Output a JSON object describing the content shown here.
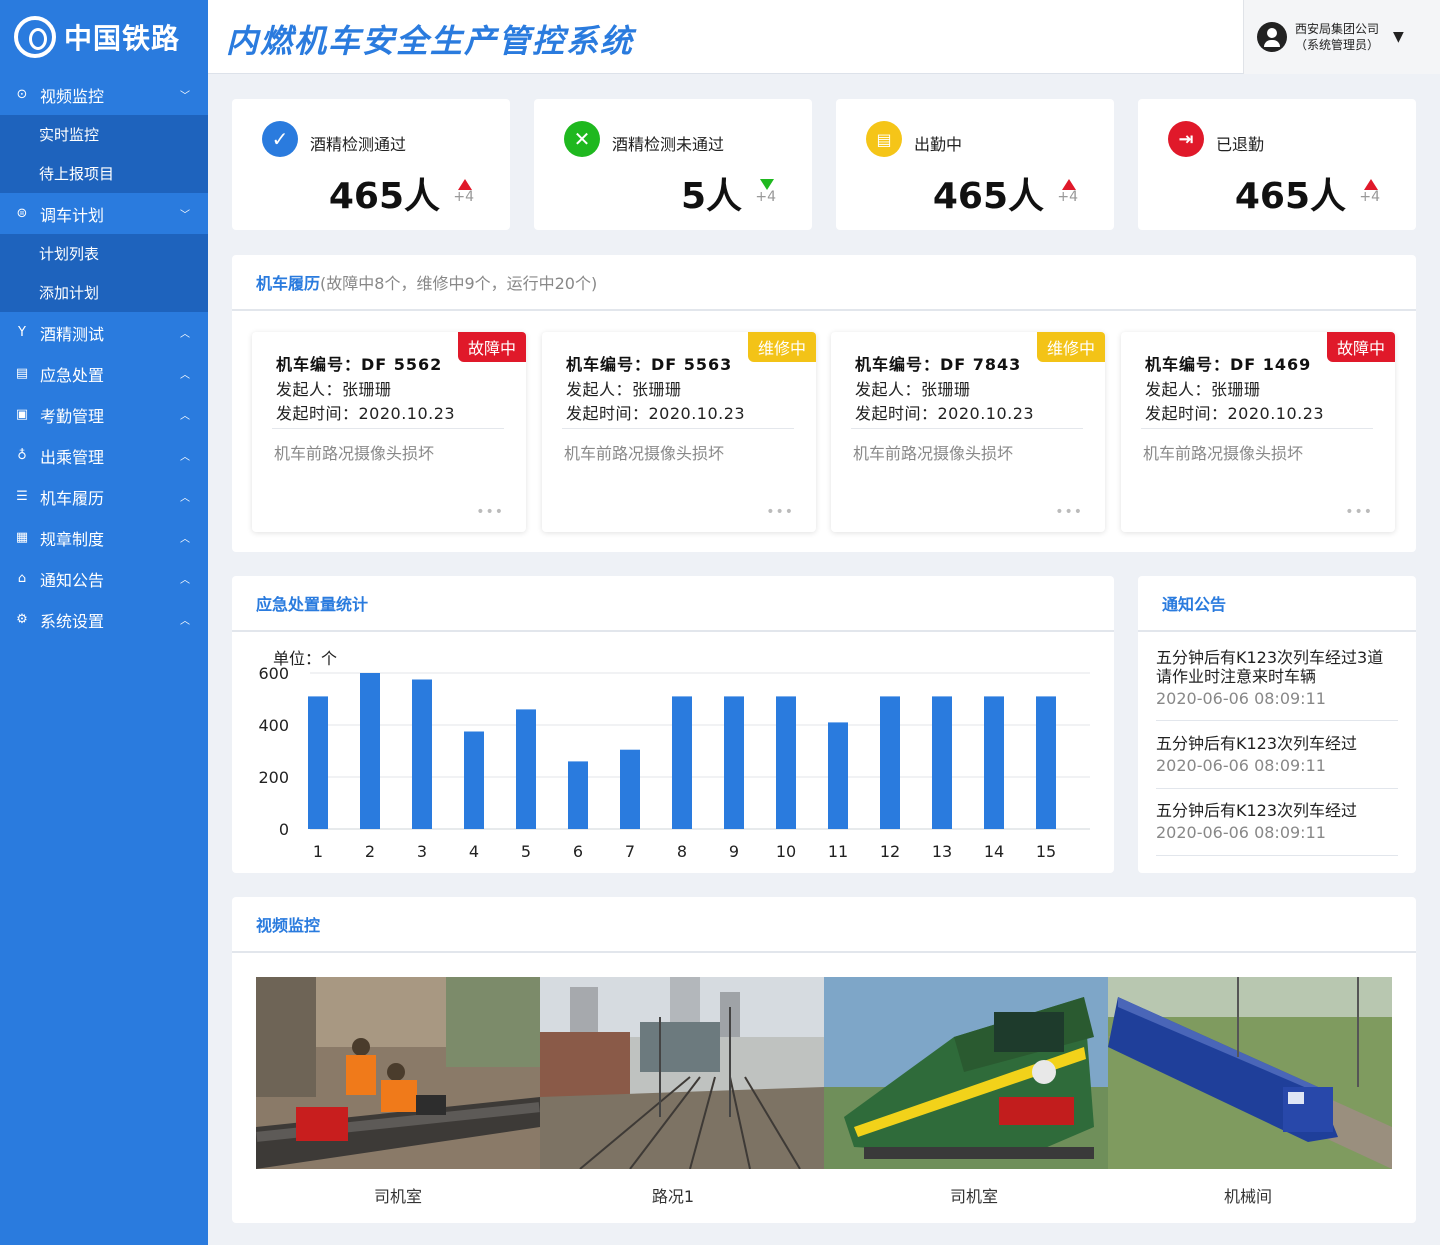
{
  "app": {
    "logo_text": "中国铁路",
    "title": "内燃机车安全生产管控系统"
  },
  "user": {
    "company": "西安局集团公司",
    "role": "（系统管理员）"
  },
  "sidebar": {
    "groups": [
      {
        "label": "视频监控",
        "icon": "camera-icon",
        "expanded": true,
        "children": [
          "实时监控",
          "待上报项目"
        ]
      },
      {
        "label": "调车计划",
        "icon": "plan-icon",
        "expanded": true,
        "children": [
          "计划列表",
          "添加计划"
        ]
      },
      {
        "label": "酒精测试",
        "icon": "glass-icon",
        "expanded": false
      },
      {
        "label": "应急处置",
        "icon": "emergency-icon",
        "expanded": false
      },
      {
        "label": "考勤管理",
        "icon": "calendar-icon",
        "expanded": false
      },
      {
        "label": "出乘管理",
        "icon": "location-icon",
        "expanded": false
      },
      {
        "label": "机车履历",
        "icon": "record-icon",
        "expanded": false
      },
      {
        "label": "规章制度",
        "icon": "rules-icon",
        "expanded": false
      },
      {
        "label": "通知公告",
        "icon": "notice-icon",
        "expanded": false
      },
      {
        "label": "系统设置",
        "icon": "gear-icon",
        "expanded": false
      }
    ]
  },
  "stats": [
    {
      "label": "酒精检测通过",
      "value": "465人",
      "delta": "+4",
      "trend": "up",
      "icon": "check-icon",
      "color": "#2a7bde"
    },
    {
      "label": "酒精检测未通过",
      "value": "5人",
      "delta": "+4",
      "trend": "down",
      "icon": "close-icon",
      "color": "#1fb81f"
    },
    {
      "label": "出勤中",
      "value": "465人",
      "delta": "+4",
      "trend": "up",
      "icon": "attendance-icon",
      "color": "#f5c518"
    },
    {
      "label": "已退勤",
      "value": "465人",
      "delta": "+4",
      "trend": "up",
      "icon": "exit-icon",
      "color": "#e0192a"
    }
  ],
  "locomotives": {
    "title": "机车履历",
    "summary": "(故障中8个，维修中9个，运行中20个)",
    "cards": [
      {
        "number": "机车编号：DF 5562",
        "status": "故障中",
        "status_color": "#e0192a",
        "initiator": "发起人：张珊珊",
        "time": "发起时间：2020.10.23",
        "desc": "机车前路况摄像头损坏",
        "more": "•••"
      },
      {
        "number": "机车编号：DF 5563",
        "status": "维修中",
        "status_color": "#f3c317",
        "initiator": "发起人：张珊珊",
        "time": "发起时间：2020.10.23",
        "desc": "机车前路况摄像头损坏",
        "more": "•••"
      },
      {
        "number": "机车编号：DF 7843",
        "status": "维修中",
        "status_color": "#f3c317",
        "initiator": "发起人：张珊珊",
        "time": "发起时间：2020.10.23",
        "desc": "机车前路况摄像头损坏",
        "more": "•••"
      },
      {
        "number": "机车编号：DF 1469",
        "status": "故障中",
        "status_color": "#e0192a",
        "initiator": "发起人：张珊珊",
        "time": "发起时间：2020.10.23",
        "desc": "机车前路况摄像头损坏",
        "more": "•••"
      }
    ]
  },
  "emergency": {
    "title": "应急处置量统计",
    "unit_label": "单位：个",
    "chart_data": {
      "type": "bar",
      "title": "应急处置量统计",
      "xlabel": "",
      "ylabel": "单位：个",
      "categories": [
        "1",
        "2",
        "3",
        "4",
        "5",
        "6",
        "7",
        "8",
        "9",
        "10",
        "11",
        "12",
        "13",
        "14",
        "15"
      ],
      "values": [
        510,
        600,
        575,
        375,
        460,
        260,
        305,
        510,
        510,
        510,
        410,
        510,
        510,
        510,
        510
      ],
      "ylim": [
        0,
        600
      ],
      "yticks": [
        "0",
        "200",
        "400",
        "600"
      ],
      "bar_color": "#2a7bde",
      "grid": true
    }
  },
  "notices": {
    "title": "通知公告",
    "items": [
      {
        "text": "五分钟后有K123次列车经过3道请作业时注意来时车辆",
        "time": "2020-06-06 08:09:11"
      },
      {
        "text": "五分钟后有K123次列车经过",
        "time": "2020-06-06 08:09:11"
      },
      {
        "text": "五分钟后有K123次列车经过",
        "time": "2020-06-06 08:09:11"
      }
    ]
  },
  "video": {
    "title": "视频监控",
    "tiles": [
      {
        "label": "司机室"
      },
      {
        "label": "路况1"
      },
      {
        "label": "司机室"
      },
      {
        "label": "机械间"
      }
    ]
  }
}
